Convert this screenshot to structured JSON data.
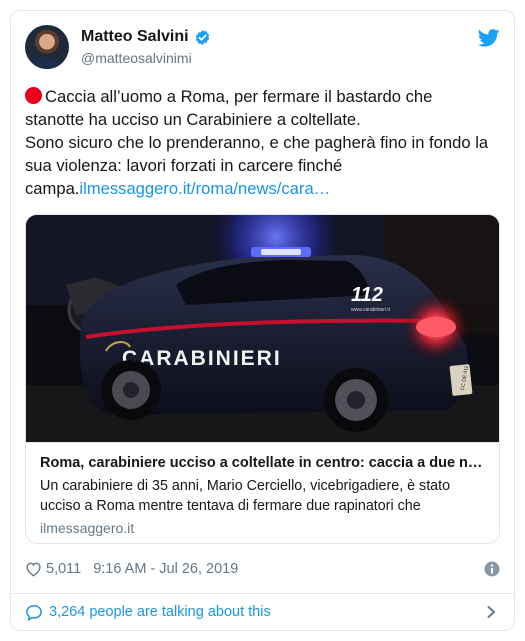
{
  "author": {
    "display_name": "Matteo Salvini",
    "handle": "@matteosalvinimi",
    "verified": true
  },
  "tweet": {
    "line1": "Caccia all’uomo a Roma, per fermare il bastardo che",
    "line2": "stanotte ha ucciso un Carabiniere a coltellate.",
    "line3": "Sono sicuro che lo prenderanno, e che pagherà fino in fondo la",
    "line4": "sua violenza: lavori forzati in carcere finché",
    "line5_prefix": "campa.",
    "line5_link": "ilmessaggero.it/roma/news/cara…"
  },
  "card": {
    "title": "Roma, carabiniere ucciso a coltellate in centro: caccia a due n…",
    "description_line1": "Un carabiniere di 35 anni, Mario Cerciello, vicebrigadiere, è stato",
    "description_line2": "ucciso a Roma mentre tentava di fermare due rapinatori che",
    "domain": "ilmessaggero.it",
    "image": {
      "car_text": "CARABINIERI",
      "car_number": "112",
      "car_site": "www.carabinieri.it",
      "plate": "CC DE 411"
    }
  },
  "meta": {
    "likes": "5,011",
    "timestamp": "9:16 AM - Jul 26, 2019"
  },
  "conversation": {
    "label": "3,264 people are talking about this"
  },
  "colors": {
    "link": "#1b95e0",
    "secondary": "#657786",
    "verified": "#1da1f2",
    "border": "#e1e8ed"
  },
  "icons": [
    "verified-badge-icon",
    "twitter-bird-icon",
    "red-circle-emoji-icon",
    "heart-icon",
    "info-icon",
    "speech-bubble-icon",
    "chevron-right-icon"
  ]
}
